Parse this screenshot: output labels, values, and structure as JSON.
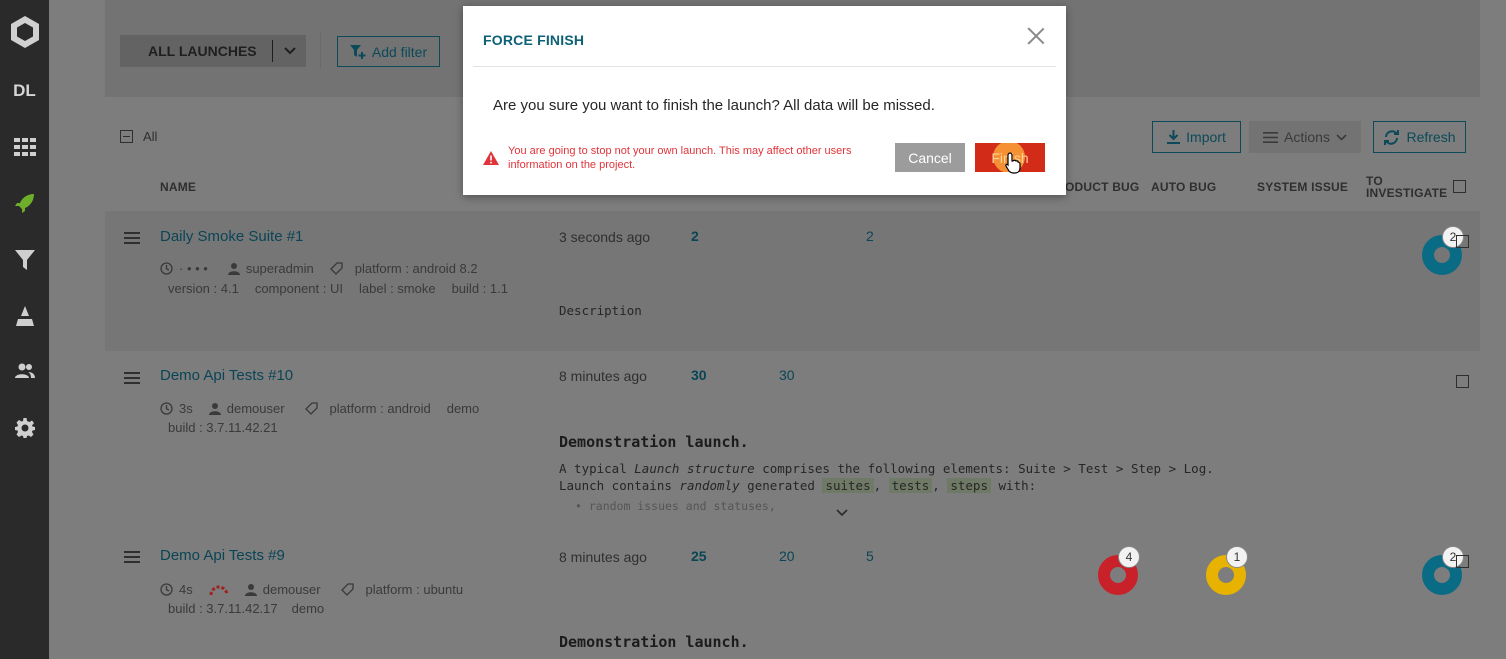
{
  "sidebar": {
    "logo_icon": "reportportal-logo-icon",
    "project_initials": "DL",
    "items": [
      {
        "icon": "dashboard-grid-icon"
      },
      {
        "icon": "rocket-launches-icon",
        "active": true
      },
      {
        "icon": "filter-icon"
      },
      {
        "icon": "debug-icon"
      },
      {
        "icon": "members-icon"
      },
      {
        "icon": "settings-gear-icon"
      }
    ]
  },
  "toolbar": {
    "launch_select": "ALL LAUNCHES",
    "add_filter": "Add filter",
    "all_label": "All",
    "import": "Import",
    "actions": "Actions",
    "refresh": "Refresh"
  },
  "columns": {
    "name": "NAME",
    "product_bug": "ODUCT BUG",
    "auto_bug": "AUTO BUG",
    "system_issue": "SYSTEM ISSUE",
    "to_investigate_1": "TO",
    "to_investigate_2": "INVESTIGATE"
  },
  "launches": [
    {
      "title": "Daily Smoke Suite #1",
      "duration": "· •   •   •",
      "owner": "superadmin",
      "attrs_line1": "platform : android 8.2",
      "attrs_line2": [
        "version : 4.1",
        "component : UI",
        "label : smoke",
        "build : 1.1"
      ],
      "time": "3 seconds ago",
      "total": "2",
      "passed": "",
      "failed": "2",
      "description": "Description",
      "to_investigate": "2"
    },
    {
      "title": "Demo Api Tests #10",
      "duration": "3s",
      "owner": "demouser",
      "attrs_line1": "platform : android",
      "attrs_line1_extra": "demo",
      "attrs_line2": [
        "build : 3.7.11.42.21"
      ],
      "time": "8 minutes ago",
      "total": "30",
      "passed": "30",
      "desc_heading": "Demonstration launch.",
      "desc_line1_a": "A typical ",
      "desc_line1_b": "Launch structure",
      "desc_line1_c": " comprises the following elements: Suite > Test > Step > Log.",
      "desc_line2_a": "Launch contains ",
      "desc_line2_b": "randomly",
      "desc_line2_c": " generated ",
      "tag_suites": "suites",
      "tag_tests": "tests",
      "tag_steps": "steps",
      "desc_line2_end": " with:",
      "desc_line3": "• random issues and statuses,"
    },
    {
      "title": "Demo Api Tests #9",
      "duration": "4s",
      "owner": "demouser",
      "attrs_line1": "platform : ubuntu",
      "attrs_line2": [
        "build : 3.7.11.42.17",
        "demo"
      ],
      "time": "8 minutes ago",
      "total": "25",
      "passed": "20",
      "failed": "5",
      "product_bug": "4",
      "auto_bug": "1",
      "to_investigate": "2",
      "desc_heading": "Demonstration launch."
    }
  ],
  "modal": {
    "title": "FORCE FINISH",
    "message": "Are you sure you want to finish the launch? All data will be missed.",
    "warning": "You are going to stop not your own launch. This may affect other users information on the project.",
    "cancel": "Cancel",
    "finish": "Finish"
  },
  "colors": {
    "accent": "#0d6177",
    "danger": "#d22b17",
    "product_bug": "#c8212a",
    "auto_bug": "#e8b300",
    "to_investigate": "#0a6b84"
  }
}
